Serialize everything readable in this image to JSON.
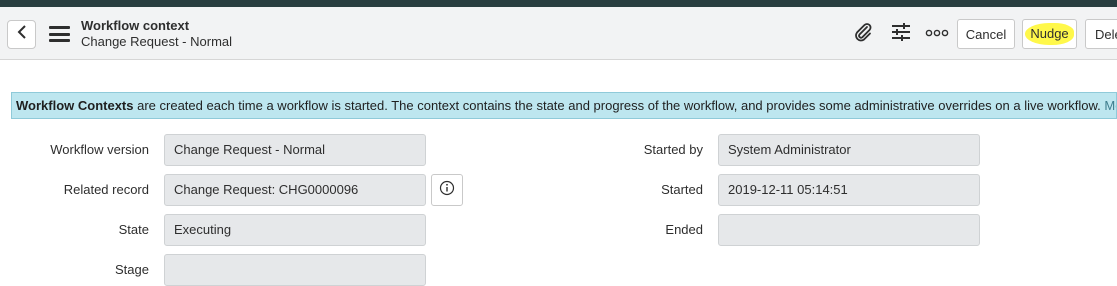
{
  "header": {
    "title": "Workflow context",
    "subtitle": "Change Request - Normal",
    "buttons": {
      "cancel": "Cancel",
      "nudge": "Nudge",
      "delete": "Delete"
    },
    "icons": [
      "back-icon",
      "hamburger-menu-icon",
      "paperclip-icon",
      "sliders-icon",
      "more-options-icon"
    ],
    "highlight_color": "#fff84a"
  },
  "banner": {
    "bold": "Workflow Contexts",
    "text": " are created each time a workflow is started. The context contains the state and progress of the workflow, and provides some administrative overrides on a live workflow. ",
    "link": "More Info"
  },
  "form": {
    "workflow_version": {
      "label": "Workflow version",
      "value": "Change Request - Normal"
    },
    "related_record": {
      "label": "Related record",
      "value": "Change Request: CHG0000096"
    },
    "state": {
      "label": "State",
      "value": "Executing"
    },
    "stage": {
      "label": "Stage",
      "value": ""
    },
    "started_by": {
      "label": "Started by",
      "value": "System Administrator"
    },
    "started": {
      "label": "Started",
      "value": "2019-12-11 05:14:51"
    },
    "ended": {
      "label": "Ended",
      "value": ""
    }
  }
}
